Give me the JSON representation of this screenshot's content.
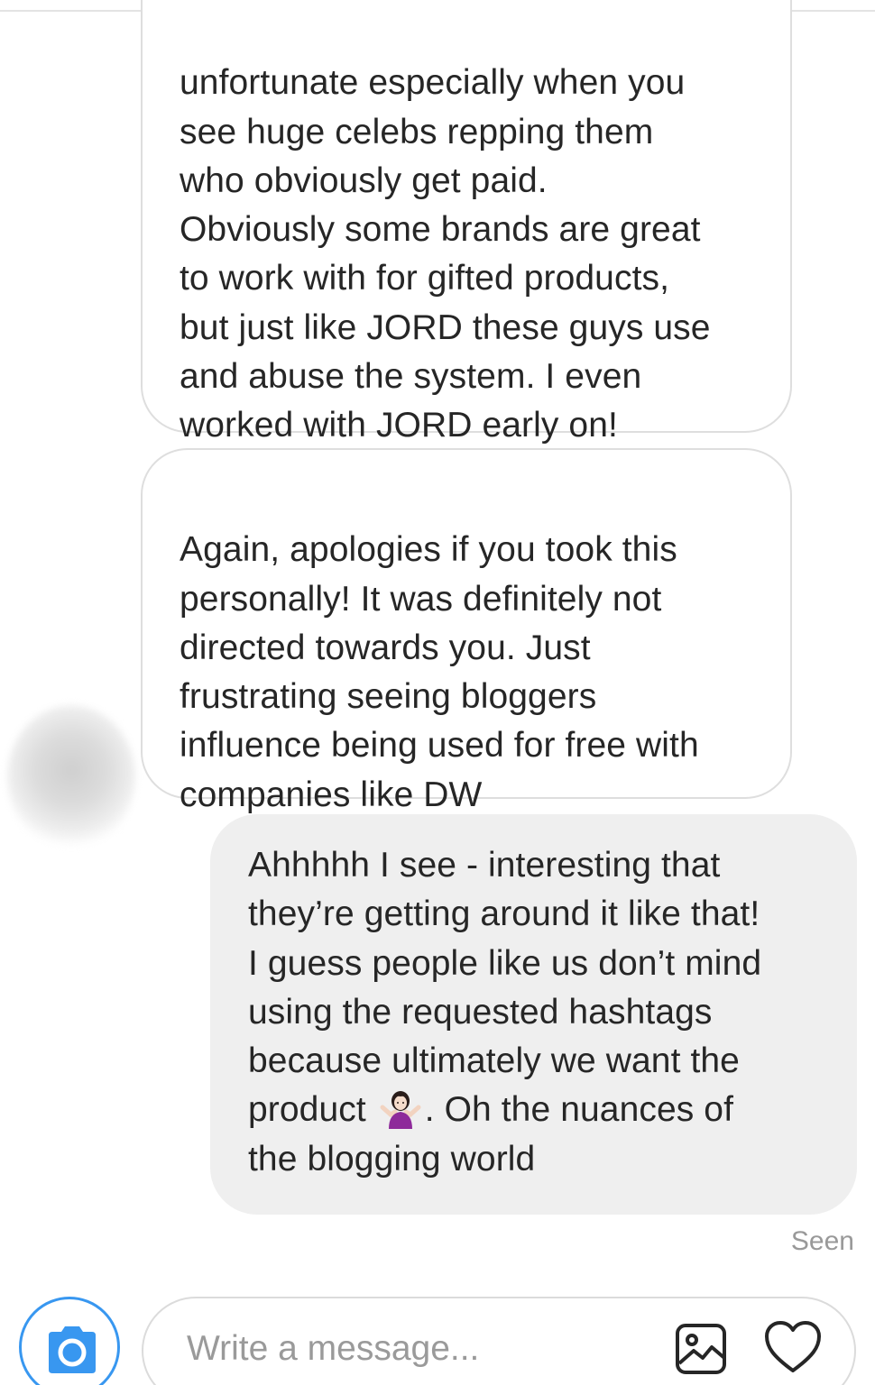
{
  "conversation": {
    "messages": [
      {
        "direction": "incoming",
        "text": "unfortunate especially when you\nsee huge celebs repping them\nwho obviously get paid.\nObviously some brands are great\nto work with for gifted products,\nbut just like JORD these guys use\nand abuse the system. I even\nworked with JORD early on!"
      },
      {
        "direction": "incoming",
        "text": "Again, apologies if you took this\npersonally! It was definitely not\ndirected towards you. Just\nfrustrating seeing bloggers\ninfluence being used for free with\ncompanies like DW"
      },
      {
        "direction": "outgoing",
        "text_before_emoji": "Ahhhhh I see - interesting that\nthey’re getting around it like that!\nI guess people like us don’t mind\nusing the requested hashtags\nbecause ultimately we want the\nproduct ",
        "emoji": "person-shrugging-emoji",
        "text_after_emoji": ". Oh the nuances of\nthe blogging world"
      }
    ],
    "status": "Seen"
  },
  "composer": {
    "placeholder": "Write a message...",
    "camera_icon": "camera-icon",
    "gallery_icon": "image-gallery-icon",
    "heart_icon": "heart-icon"
  },
  "colors": {
    "accent": "#3897f0",
    "outgoing_bubble": "#efefef",
    "incoming_border": "#dedede",
    "text": "#262626",
    "muted": "#999999"
  }
}
